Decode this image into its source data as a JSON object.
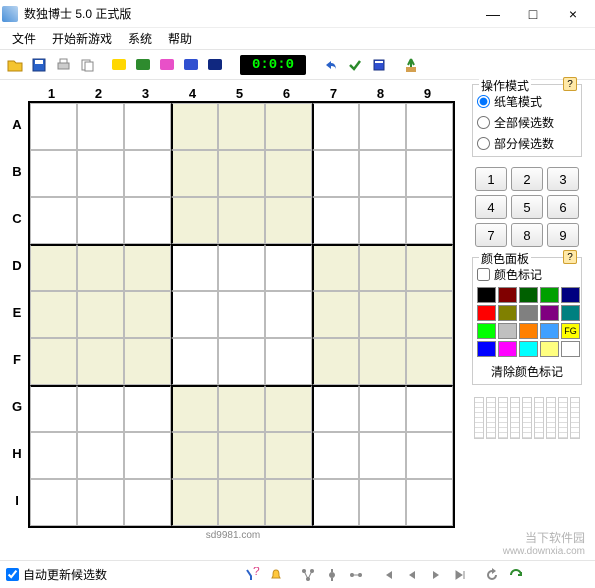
{
  "window": {
    "title": "数独博士 5.0 正式版",
    "min": "—",
    "max": "□",
    "close": "×"
  },
  "menu": {
    "file": "文件",
    "newgame": "开始新游戏",
    "system": "系统",
    "help": "帮助"
  },
  "timer": {
    "display": "0:0:0"
  },
  "grid": {
    "cols": [
      "1",
      "2",
      "3",
      "4",
      "5",
      "6",
      "7",
      "8",
      "9"
    ],
    "rows": [
      "A",
      "B",
      "C",
      "D",
      "E",
      "F",
      "G",
      "H",
      "I"
    ]
  },
  "mode": {
    "title": "操作模式",
    "opt1": "纸笔模式",
    "opt2": "全部候选数",
    "opt3": "部分候选数"
  },
  "numpad": [
    "1",
    "2",
    "3",
    "4",
    "5",
    "6",
    "7",
    "8",
    "9"
  ],
  "colorpanel": {
    "title": "颜色面板",
    "marklabel": "颜色标记",
    "fg": "FG",
    "clear": "清除颜色标记"
  },
  "footer": {
    "autorefresh": "自动更新候选数",
    "url": "sd9981.com"
  },
  "watermark": {
    "main": "当下软件园",
    "sub": "www.downxia.com"
  }
}
